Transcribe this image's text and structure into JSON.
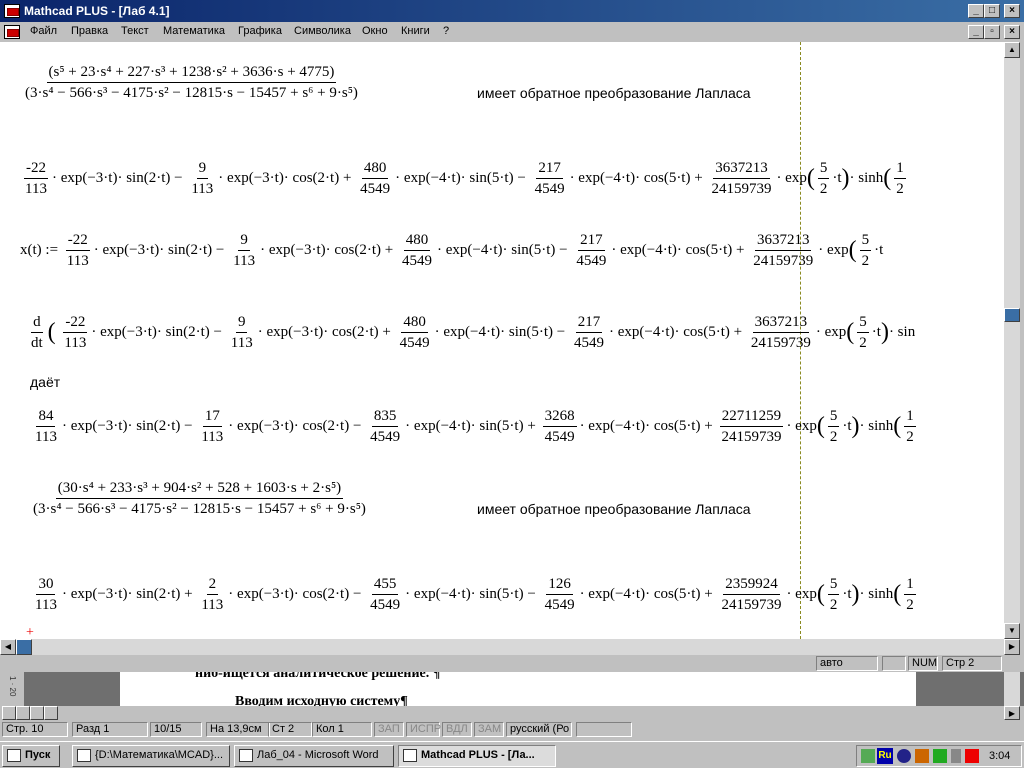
{
  "window": {
    "title": "Mathcad PLUS - [Лаб 4.1]"
  },
  "menu": {
    "items": [
      "Файл",
      "Правка",
      "Текст",
      "Математика",
      "Графика",
      "Символика",
      "Окно",
      "Книги",
      "?"
    ]
  },
  "doc": {
    "frac1_num": "(s⁵ + 23·s⁴ + 227·s³ + 1238·s² + 3636·s + 4775)",
    "frac1_den": "(3·s⁴ − 566·s³ − 4175·s² − 12815·s − 15457 + s⁶ + 9·s⁵)",
    "laplace_label": "имеет обратное преобразование Лапласа",
    "line1": [
      "-22",
      "113",
      "· exp(−3·t)· sin(2·t) −",
      "9",
      "113",
      "· exp(−3·t)· cos(2·t) +",
      "480",
      "4549",
      "· exp(−4·t)· sin(5·t) −",
      "217",
      "4549",
      "· exp(−4·t)· cos(5·t) +",
      "3637213",
      "24159739",
      "· exp",
      "5",
      "2",
      "·t",
      "· sinh",
      "1",
      "2"
    ],
    "xdef_lhs": "x(t)  :=",
    "line2": [
      "-22",
      "113",
      "· exp(−3·t)· sin(2·t) −",
      "9",
      "113",
      "· exp(−3·t)· cos(2·t) +",
      "480",
      "4549",
      "· exp(−4·t)· sin(5·t) −",
      "217",
      "4549",
      "· exp(−4·t)· cos(5·t) +",
      "3637213",
      "24159739",
      "· exp",
      "5",
      "2",
      "·t"
    ],
    "deriv_d": "d",
    "deriv_dt": "dt",
    "line3": [
      "-22",
      "113",
      "· exp(−3·t)· sin(2·t) −",
      "9",
      "113",
      "· exp(−3·t)· cos(2·t) +",
      "480",
      "4549",
      "· exp(−4·t)· sin(5·t) −",
      "217",
      "4549",
      "· exp(−4·t)· cos(5·t) +",
      "3637213",
      "24159739",
      "· exp",
      "5",
      "2",
      "·t",
      "· sin"
    ],
    "gives": "даёт",
    "line4": [
      "84",
      "113",
      "· exp(−3·t)· sin(2·t) −",
      "17",
      "113",
      "· exp(−3·t)· cos(2·t) −",
      "835",
      "4549",
      "· exp(−4·t)· sin(5·t) +",
      "3268",
      "4549",
      "· exp(−4·t)· cos(5·t) +",
      "22711259",
      "24159739",
      "· exp",
      "5",
      "2",
      "·t",
      "· sinh",
      "1",
      "2"
    ],
    "frac2_num": "(30·s⁴ + 233·s³ + 904·s² + 528 + 1603·s + 2·s⁵)",
    "frac2_den": "(3·s⁴ − 566·s³ − 4175·s² − 12815·s − 15457 + s⁶ + 9·s⁵)",
    "line5": [
      "30",
      "113",
      "· exp(−3·t)· sin(2·t) +",
      "2",
      "113",
      "· exp(−3·t)· cos(2·t) −",
      "455",
      "4549",
      "· exp(−4·t)· sin(5·t) −",
      "126",
      "4549",
      "· exp(−4·t)· cos(5·t) +",
      "2359924",
      "24159739",
      "· exp",
      "5",
      "2",
      "·t",
      "· sinh",
      "1",
      "2"
    ]
  },
  "mathcad_status": {
    "mode": "авто",
    "num": "NUM",
    "page": "Стр 2"
  },
  "word": {
    "line_a": "ниб-ищется аналитическое решение. ¶",
    "line_b": "Вводим исходную систему¶",
    "ruler": "1 · 20"
  },
  "word_status": {
    "page": "Стр. 10",
    "section": "Разд 1",
    "pages": "10/15",
    "at": "На 13,9см",
    "line": "Ст 2",
    "col": "Кол 1",
    "rec": "ЗАП",
    "trk": "ИСПР",
    "ext": "ВДЛ",
    "ovr": "ЗАМ",
    "lang": "русский (Ро"
  },
  "taskbar": {
    "start": "Пуск",
    "items": [
      "{D:\\Математика\\MCAD}...",
      "Лаб_04 - Microsoft Word",
      "Mathcad PLUS - [Ла..."
    ],
    "clock": "3:04",
    "tray_lang": "Ru"
  }
}
